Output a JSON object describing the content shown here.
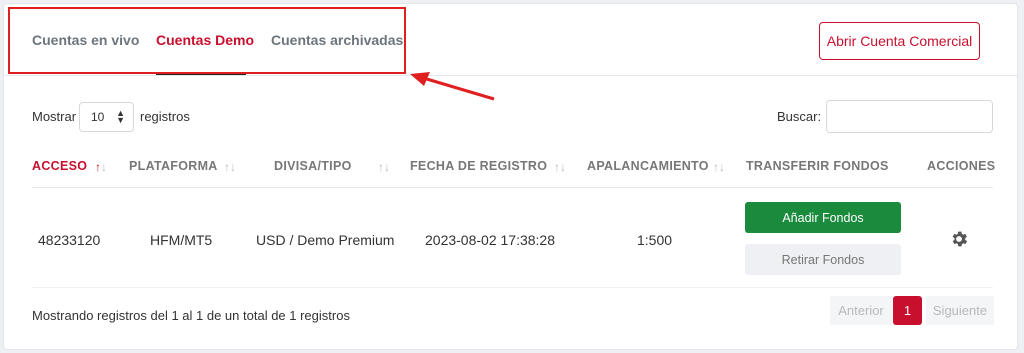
{
  "tabs": [
    {
      "label": "Cuentas en vivo",
      "active": false
    },
    {
      "label": "Cuentas Demo",
      "active": true
    },
    {
      "label": "Cuentas archivadas",
      "active": false
    }
  ],
  "open_account_button": "Abrir Cuenta Comercial",
  "controls": {
    "show_label": "Mostrar",
    "show_value": "10",
    "records_label": "registros",
    "search_label": "Buscar:",
    "search_value": ""
  },
  "table": {
    "headers": [
      "ACCESO",
      "PLATAFORMA",
      "DIVISA/TIPO",
      "FECHA DE REGISTRO",
      "APALANCAMIENTO",
      "TRANSFERIR FONDOS",
      "ACCIONES"
    ],
    "sorted_column": "ACCESO",
    "rows": [
      {
        "acceso": "48233120",
        "plataforma": "HFM/MT5",
        "divisa_tipo": "USD / Demo Premium",
        "fecha": "2023-08-02 17:38:28",
        "apalancamiento": "1:500"
      }
    ],
    "add_funds_label": "Añadir Fondos",
    "withdraw_funds_label": "Retirar Fondos",
    "actions_icon": "gear-icon"
  },
  "footer": {
    "summary": "Mostrando registros del 1 al 1 de un total de 1 registros",
    "prev_label": "Anterior",
    "current_page": "1",
    "next_label": "Siguiente"
  },
  "colors": {
    "accent": "#c8102e",
    "annotation": "#e02020",
    "add_funds": "#1a8a3c"
  }
}
